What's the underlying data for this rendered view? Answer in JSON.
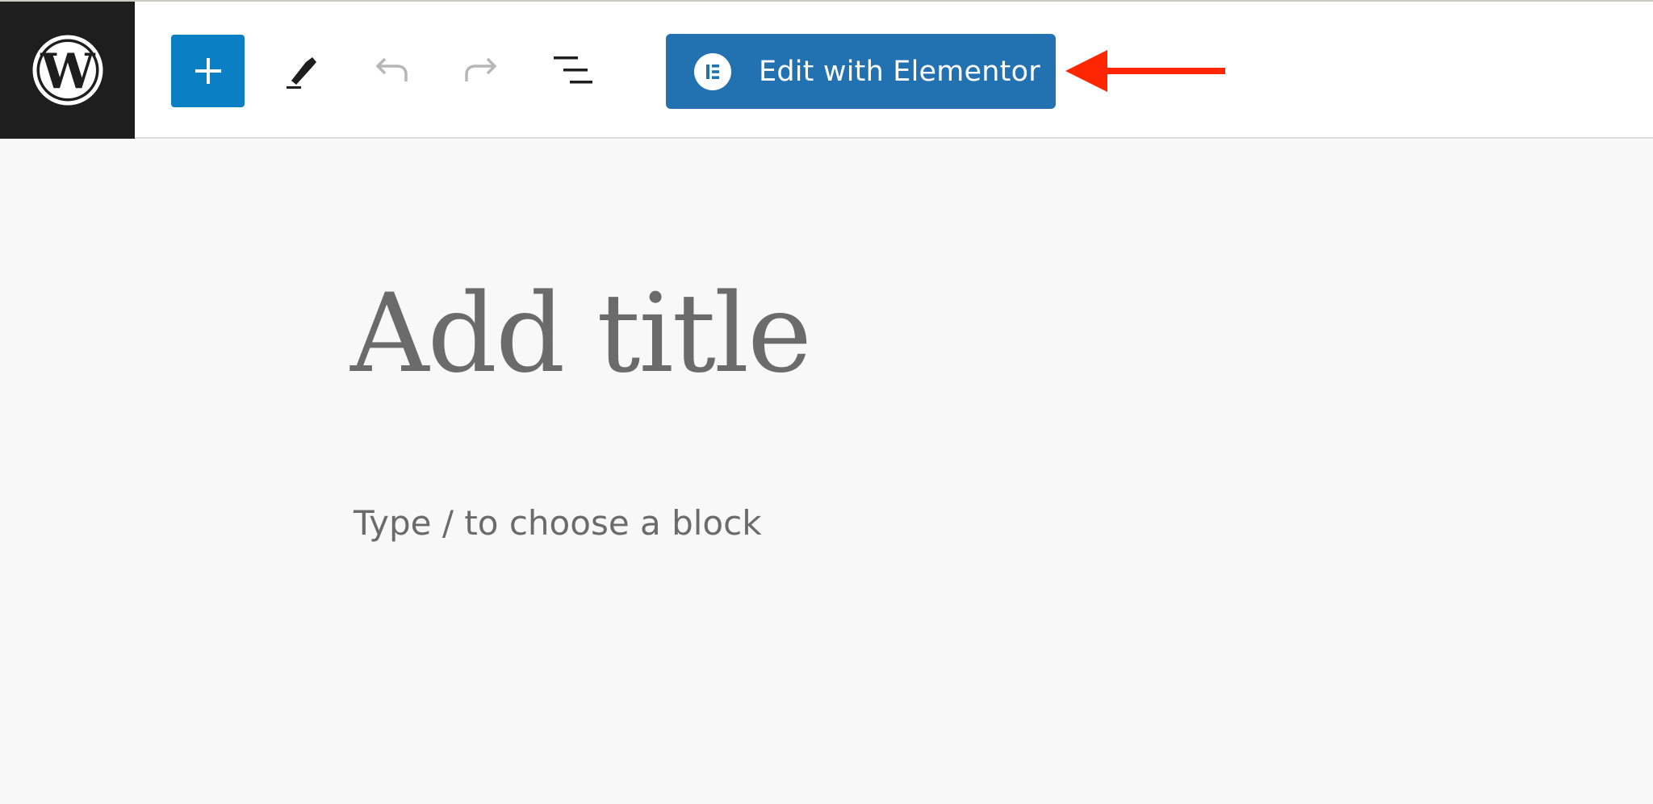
{
  "toolbar": {
    "logo_icon": "wordpress-logo-icon",
    "add_block_icon": "plus-icon",
    "tools_icon": "pencil-icon",
    "undo_icon": "undo-icon",
    "redo_icon": "redo-icon",
    "list_view_icon": "list-view-icon",
    "edit_with_elementor_label": "Edit with Elementor",
    "elementor_icon": "elementor-logo-icon",
    "annotation_icon": "red-arrow-icon"
  },
  "editor": {
    "title_placeholder": "Add title",
    "block_placeholder": "Type / to choose a block"
  },
  "colors": {
    "accent_blue": "#0b7fc4",
    "elementor_blue": "#2271b1",
    "annotation_red": "#ff2600",
    "sidebar_dark": "#1e1e1e"
  }
}
